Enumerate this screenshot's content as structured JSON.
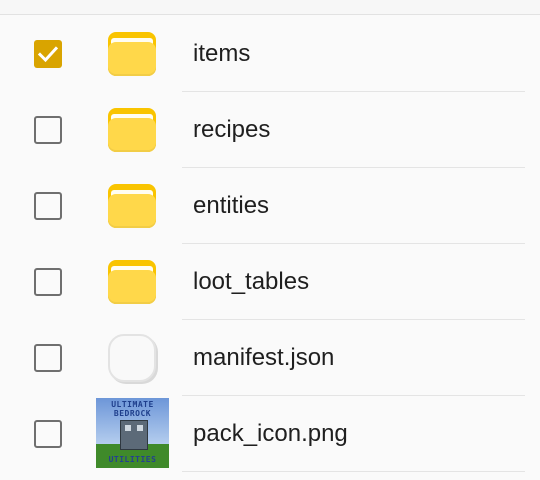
{
  "file_list": {
    "items": [
      {
        "name": "items",
        "type": "folder",
        "icon": "folder-icon",
        "checked": true
      },
      {
        "name": "recipes",
        "type": "folder",
        "icon": "folder-icon",
        "checked": false
      },
      {
        "name": "entities",
        "type": "folder",
        "icon": "folder-icon",
        "checked": false
      },
      {
        "name": "loot_tables",
        "type": "folder",
        "icon": "folder-icon",
        "checked": false
      },
      {
        "name": "manifest.json",
        "type": "file",
        "icon": "generic-file-icon",
        "checked": false
      },
      {
        "name": "pack_icon.png",
        "type": "image",
        "icon": "image-thumbnail",
        "checked": false
      }
    ],
    "thumbnail_text": {
      "line1": "ULTIMATE",
      "line2": "BEDROCK",
      "line3": "UTILITIES"
    }
  },
  "colors": {
    "checkbox_checked": "#d9a400",
    "folder": "#ffd84a",
    "text": "#1f1f1f"
  }
}
